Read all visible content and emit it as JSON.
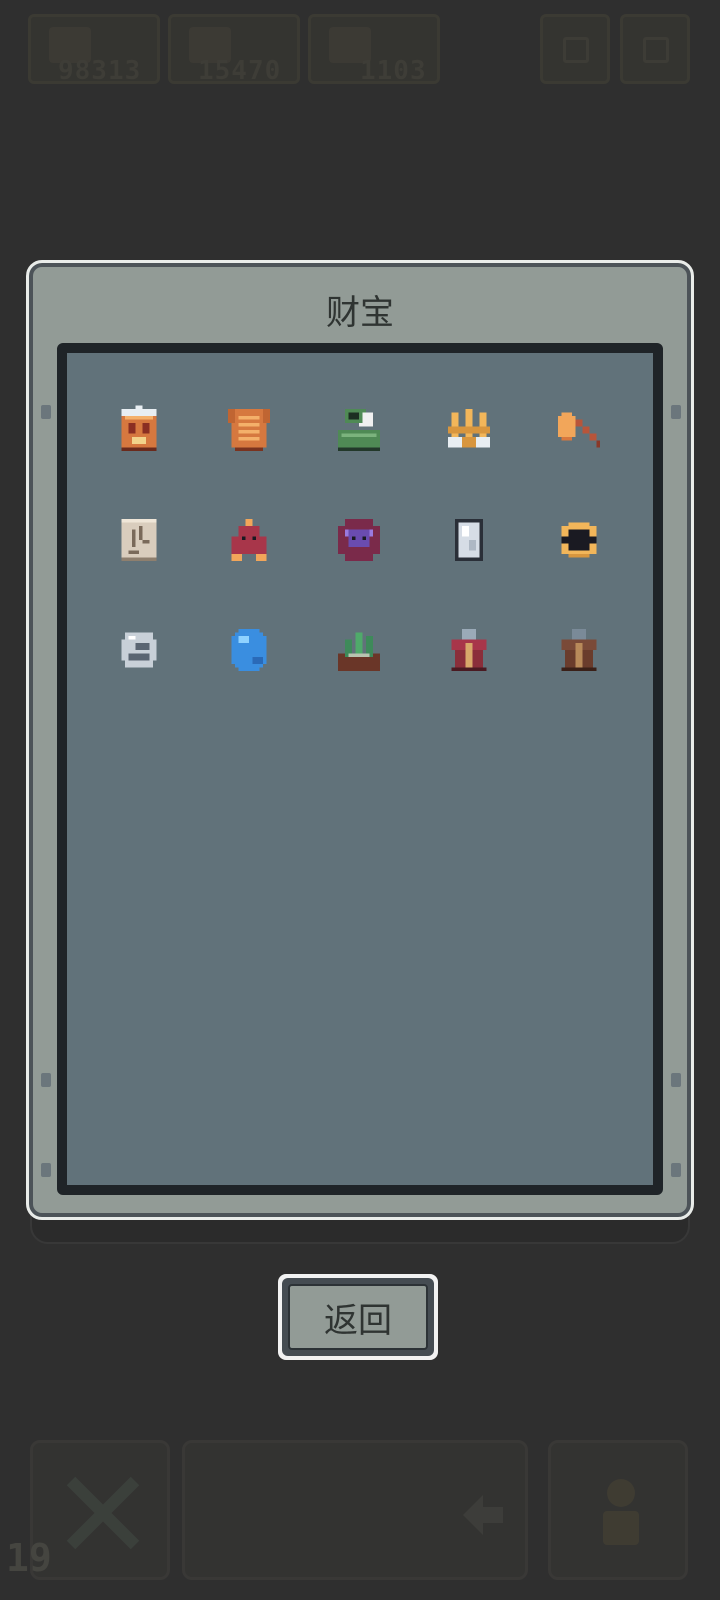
{
  "top_bar": {
    "resources": [
      {
        "icon": "sword-icon",
        "value": "98313"
      },
      {
        "icon": "gem-icon",
        "value": "15470"
      },
      {
        "icon": "potion-icon",
        "value": "1103"
      }
    ]
  },
  "panel": {
    "title": "财宝",
    "treasures": [
      {
        "icon": "lantern-icon"
      },
      {
        "icon": "leather-armor-icon"
      },
      {
        "icon": "green-helmet-icon"
      },
      {
        "icon": "golden-crown-icon"
      },
      {
        "icon": "axe-icon"
      },
      {
        "icon": "ancient-scroll-icon"
      },
      {
        "icon": "red-cloak-icon"
      },
      {
        "icon": "demon-medallion-icon"
      },
      {
        "icon": "silver-mirror-icon"
      },
      {
        "icon": "golden-ring-icon"
      },
      {
        "icon": "crescent-moon-stone-icon"
      },
      {
        "icon": "blue-orb-icon"
      },
      {
        "icon": "moss-rock-icon"
      },
      {
        "icon": "red-armor-icon"
      },
      {
        "icon": "brown-armor-icon"
      }
    ]
  },
  "back_button": {
    "label": "返回"
  },
  "bottom_bar": {
    "level": "19"
  }
}
